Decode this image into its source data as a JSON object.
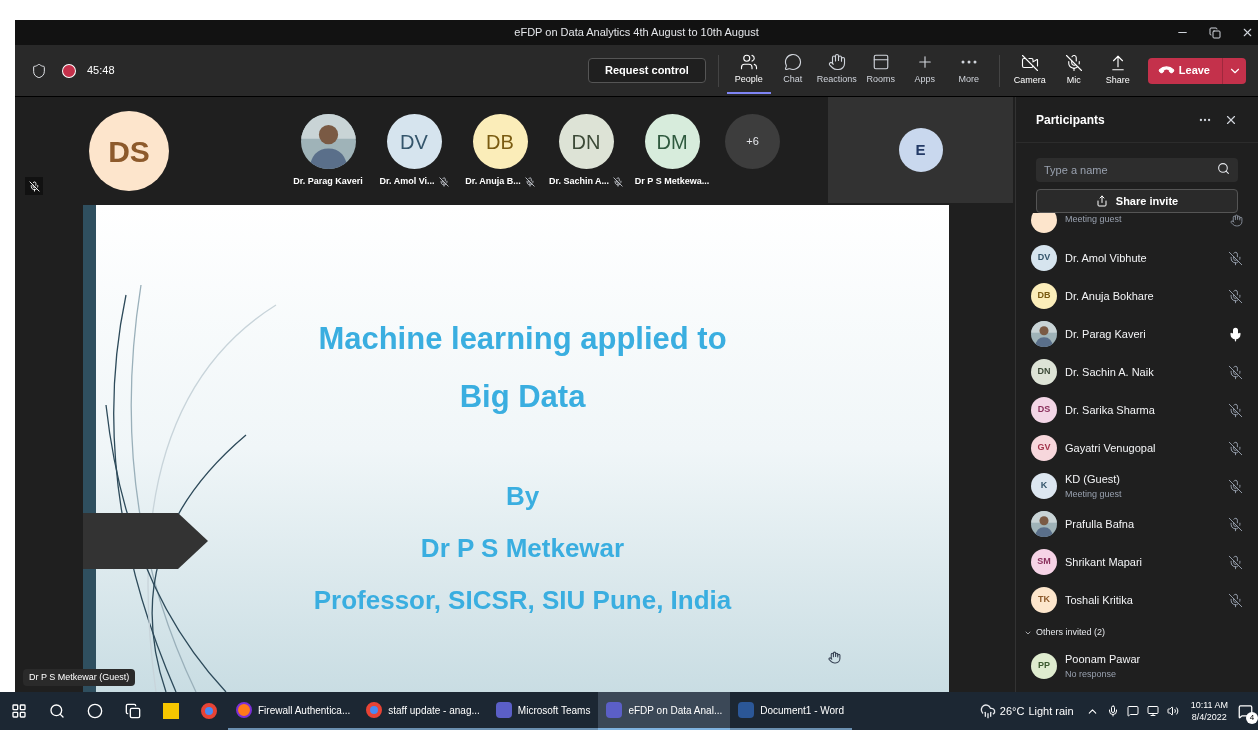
{
  "window": {
    "title": "eFDP on Data Analytics 4th August to 10th August"
  },
  "toolbar": {
    "timer": "45:48",
    "recording": true,
    "request_control": "Request control",
    "tools": [
      {
        "kind": "people",
        "label": "People",
        "selected": true
      },
      {
        "kind": "chat",
        "label": "Chat",
        "selected": false
      },
      {
        "kind": "reactions",
        "label": "Reactions",
        "selected": false
      },
      {
        "kind": "rooms",
        "label": "Rooms",
        "selected": false
      },
      {
        "kind": "apps",
        "label": "Apps",
        "selected": false
      },
      {
        "kind": "more",
        "label": "More",
        "selected": false
      }
    ],
    "devices": [
      {
        "kind": "camera",
        "label": "Camera",
        "on": false
      },
      {
        "kind": "mic",
        "label": "Mic",
        "on": false
      },
      {
        "kind": "share",
        "label": "Share",
        "on": false
      }
    ],
    "leave": "Leave"
  },
  "stage": {
    "speaker": {
      "initials": "DS",
      "color": "#fde5cc",
      "muted": true
    },
    "gallery": [
      {
        "name": "Dr. Parag Kaveri",
        "muted": false
      },
      {
        "kind": "initials",
        "initials": "DV",
        "color": "#d6e4ee",
        "name": "Dr. Amol Vi...",
        "muted": true
      },
      {
        "kind": "initials",
        "initials": "DB",
        "color": "#fbedb9",
        "name": "Dr. Anuja B...",
        "muted": true
      },
      {
        "kind": "initials",
        "initials": "DN",
        "color": "#dde3d6",
        "name": "Dr. Sachin A...",
        "muted": true
      },
      {
        "kind": "initials",
        "initials": "DM",
        "color": "#d7ecdc",
        "name": "Dr P S Metkewa...",
        "muted": false
      },
      {
        "kind": "overflow",
        "initials": "+6"
      }
    ],
    "side_tile": {
      "initials": "E",
      "color": "#c9d8ee"
    },
    "slide": {
      "lines": [
        {
          "kind": "title",
          "text": "Machine learning applied to"
        },
        {
          "kind": "title",
          "text": "Big Data"
        },
        {
          "kind": "gap"
        },
        {
          "kind": "author",
          "text": "By"
        },
        {
          "kind": "author",
          "text": "Dr P S Metkewar"
        },
        {
          "kind": "author",
          "text": "Professor, SICSR, SIU Pune, India"
        }
      ]
    },
    "caption": "Dr P S Metkewar (Guest)"
  },
  "panel": {
    "title": "Participants",
    "search": {
      "placeholder": "Type a name"
    },
    "share_invite": "Share invite",
    "participants": [
      {
        "kind": "initials",
        "color": "#fde5cc",
        "subtitle": "Meeting guest",
        "hand_raised": true,
        "partial": true
      },
      {
        "kind": "initials",
        "initials": "DV",
        "color": "#d6e4ee",
        "name": "Dr. Amol Vibhute",
        "muted": true
      },
      {
        "kind": "initials",
        "initials": "DB",
        "color": "#fbedb9",
        "name": "Dr. Anuja Bokhare",
        "muted": true
      },
      {
        "name": "Dr. Parag Kaveri",
        "muted": false
      },
      {
        "kind": "initials",
        "initials": "DN",
        "color": "#dde3d6",
        "name": "Dr. Sachin A. Naik",
        "muted": true
      },
      {
        "kind": "initials",
        "initials": "DS",
        "color": "#f3d6e6",
        "name": "Dr. Sarika Sharma",
        "muted": true
      },
      {
        "kind": "initials",
        "initials": "GV",
        "color": "#f7d7dc",
        "name": "Gayatri Venugopal",
        "muted": true
      },
      {
        "kind": "initials",
        "initials": "K",
        "color": "#dce6f0",
        "name": "KD (Guest)",
        "subtitle": "Meeting guest",
        "muted": true
      },
      {
        "name": "Prafulla Bafna",
        "muted": true
      },
      {
        "kind": "initials",
        "initials": "SM",
        "color": "#f6d3e6",
        "name": "Shrikant Mapari",
        "muted": true
      },
      {
        "kind": "initials",
        "initials": "TK",
        "color": "#fde6cc",
        "name": "Toshali Kritika",
        "muted": true
      }
    ],
    "invited": {
      "label": "Others invited (2)",
      "expanded": true,
      "people": [
        {
          "initials": "PP",
          "color": "#dfeccf",
          "name": "Poonam Pawar",
          "subtitle": "No response"
        }
      ]
    }
  },
  "taskbar": {
    "pinned": [
      {
        "kind": "start"
      },
      {
        "kind": "search"
      },
      {
        "kind": "cortana"
      },
      {
        "kind": "taskview"
      },
      {
        "kind": "sticky"
      },
      {
        "kind": "chrome"
      }
    ],
    "apps": [
      {
        "kind": "firefox",
        "label": "Firewall Authentica...",
        "selected": false
      },
      {
        "kind": "chrome",
        "label": "staff update - anag...",
        "selected": false
      },
      {
        "kind": "teams",
        "label": "Microsoft Teams",
        "selected": false
      },
      {
        "kind": "teams",
        "label": "eFDP on Data Anal...",
        "selected": true
      },
      {
        "kind": "word",
        "label": "Document1 - Word",
        "selected": false
      }
    ],
    "weather": {
      "temp": "26°C",
      "text": "Light rain"
    },
    "time": "10:11 AM",
    "date": "8/4/2022",
    "badge": "4"
  }
}
